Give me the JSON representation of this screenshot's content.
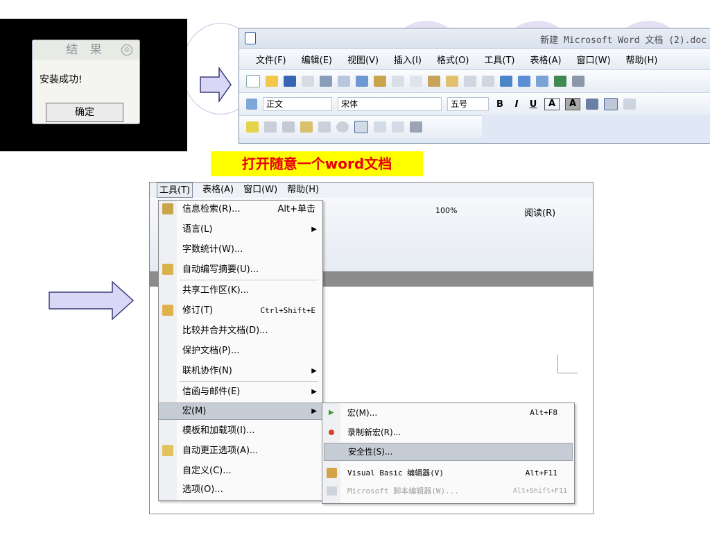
{
  "dialog": {
    "title": "结 果",
    "close_glyph": "◎",
    "message": "安装成功!",
    "ok_label": "确定"
  },
  "word_window": {
    "title": "新建 Microsoft Word 文档 (2).doc",
    "menu": [
      "文件(F)",
      "编辑(E)",
      "视图(V)",
      "插入(I)",
      "格式(O)",
      "工具(T)",
      "表格(A)",
      "窗口(W)",
      "帮助(H)"
    ],
    "style_value": "正文",
    "font_value": "宋体",
    "size_value": "五号",
    "format_buttons": [
      "B",
      "I",
      "U",
      "A",
      "A"
    ]
  },
  "caption": "打开随意一个word文档",
  "lower_window": {
    "menu": [
      "工具(T)",
      "表格(A)",
      "窗口(W)",
      "帮助(H)"
    ],
    "zoom": "100%",
    "read_label": "阅读(R)"
  },
  "tools_menu": [
    {
      "label": "信息检索(R)...",
      "shortcut": "Alt+单击",
      "icon": "research-icon"
    },
    {
      "label": "语言(L)",
      "submenu": true
    },
    {
      "label": "字数统计(W)..."
    },
    {
      "label": "自动编写摘要(U)...",
      "icon": "autosummarize-icon"
    },
    {
      "label": "共享工作区(K)..."
    },
    {
      "label": "修订(T)",
      "shortcut": "Ctrl+Shift+E",
      "icon": "track-changes-icon"
    },
    {
      "label": "比较并合并文档(D)..."
    },
    {
      "label": "保护文档(P)..."
    },
    {
      "label": "联机协作(N)",
      "submenu": true
    },
    {
      "label": "信函与邮件(E)",
      "submenu": true
    },
    {
      "label": "宏(M)",
      "submenu": true,
      "highlighted": true
    },
    {
      "label": "模板和加载项(I)..."
    },
    {
      "label": "自动更正选项(A)...",
      "icon": "autocorrect-icon"
    },
    {
      "label": "自定义(C)..."
    },
    {
      "label": "选项(O)..."
    }
  ],
  "macro_submenu": [
    {
      "label": "宏(M)...",
      "shortcut": "Alt+F8",
      "icon": "play-icon"
    },
    {
      "label": "录制新宏(R)...",
      "icon": "record-icon"
    },
    {
      "label": "安全性(S)...",
      "highlighted": true
    },
    {
      "label": "Visual Basic 编辑器(V)",
      "shortcut": "Alt+F11",
      "icon": "vb-editor-icon"
    },
    {
      "label": "Microsoft 脚本编辑器(W)...",
      "shortcut": "Alt+Shift+F11",
      "disabled": true,
      "icon": "script-editor-icon"
    }
  ],
  "colors": {
    "caption_bg": "#ffff00",
    "caption_text": "#e8000b",
    "arrow_fill": "#d9d7f5",
    "highlight": "#c6ccd4"
  }
}
